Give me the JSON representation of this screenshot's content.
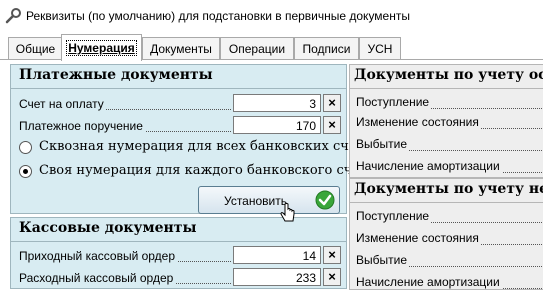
{
  "window": {
    "title": "Реквизиты (по умолчанию) для подстановки в первичные документы",
    "icon": "wrench-icon"
  },
  "tabs": [
    {
      "label": "Общие",
      "active": false
    },
    {
      "label": "Нумерация",
      "active": true
    },
    {
      "label": "Документы",
      "active": false
    },
    {
      "label": "Операции",
      "active": false
    },
    {
      "label": "Подписи",
      "active": false
    },
    {
      "label": "УСН",
      "active": false
    }
  ],
  "payment_docs": {
    "title": "Платежные документы",
    "rows": [
      {
        "label": "Счет на оплату",
        "value": "3",
        "clear": "×"
      },
      {
        "label": "Платежное поручение",
        "value": "170",
        "clear": "×"
      }
    ],
    "radios": [
      {
        "label": "Сквозная нумерация для всех банковских счетов",
        "checked": false
      },
      {
        "label": "Своя нумерация для каждого банковского счета",
        "checked": true
      }
    ],
    "set_button": "Установить"
  },
  "cash_docs": {
    "title": "Кассовые документы",
    "rows": [
      {
        "label": "Приходный кассовый ордер",
        "value": "14",
        "clear": "×"
      },
      {
        "label": "Расходный кассовый ордер",
        "value": "233",
        "clear": "×"
      }
    ]
  },
  "fixed_assets": {
    "title": "Документы по учету осно",
    "items": [
      "Поступление",
      "Изменение состояния",
      "Выбытие",
      "Начисление амортизации"
    ]
  },
  "intangible_assets": {
    "title": "Документы по учету нема",
    "items": [
      "Поступление",
      "Изменение состояния",
      "Выбытие",
      "Начисление амортизации"
    ]
  },
  "colors": {
    "left_panel_bg": "#d8ecf2",
    "right_panel_bg": "#eeeeee",
    "ok_green": "#3aa63a"
  }
}
